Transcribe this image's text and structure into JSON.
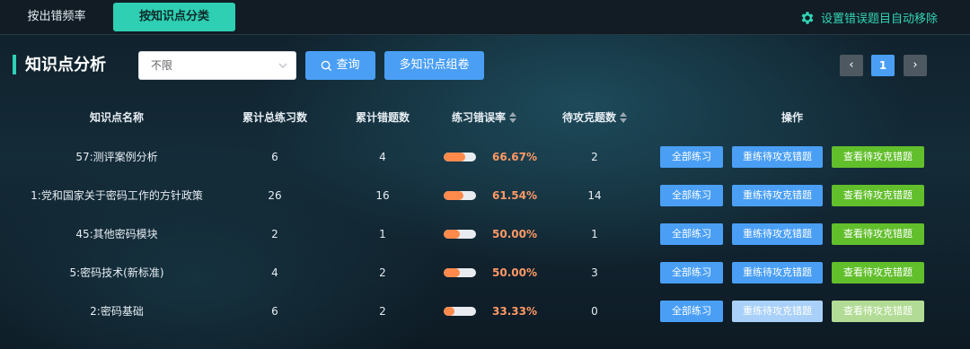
{
  "tabs": [
    {
      "label": "按出错频率",
      "active": false
    },
    {
      "label": "按知识点分类",
      "active": true
    }
  ],
  "settings_label": "设置错误题目自动移除",
  "section_title": "知识点分析",
  "filter": {
    "selected": "不限"
  },
  "buttons": {
    "search": "查询",
    "multi_compose": "多知识点组卷"
  },
  "pagination": {
    "prev": "‹",
    "current": "1",
    "next": "›"
  },
  "columns": {
    "name": "知识点名称",
    "total_practice": "累计总练习数",
    "total_errors": "累计错题数",
    "error_rate": "练习错误率",
    "pending": "待攻克题数",
    "actions": "操作"
  },
  "action_labels": {
    "all_practice": "全部练习",
    "retrain": "重练待攻克错题",
    "view": "查看待攻克错题"
  },
  "rows": [
    {
      "name": "57:测评案例分析",
      "total": "6",
      "errors": "4",
      "rate": "66.67%",
      "rate_value": 0.6667,
      "pending": "2",
      "disabled": false
    },
    {
      "name": "1:党和国家关于密码工作的方针政策",
      "total": "26",
      "errors": "16",
      "rate": "61.54%",
      "rate_value": 0.6154,
      "pending": "14",
      "disabled": false
    },
    {
      "name": "45:其他密码模块",
      "total": "2",
      "errors": "1",
      "rate": "50.00%",
      "rate_value": 0.5,
      "pending": "1",
      "disabled": false
    },
    {
      "name": "5:密码技术(新标准)",
      "total": "4",
      "errors": "2",
      "rate": "50.00%",
      "rate_value": 0.5,
      "pending": "3",
      "disabled": false
    },
    {
      "name": "2:密码基础",
      "total": "6",
      "errors": "2",
      "rate": "33.33%",
      "rate_value": 0.3333,
      "pending": "0",
      "disabled": true
    }
  ],
  "colors": {
    "accent": "#2ecfb3",
    "primary": "#4a9ff5",
    "success": "#62bf2c",
    "rate": "#ff9a66"
  }
}
